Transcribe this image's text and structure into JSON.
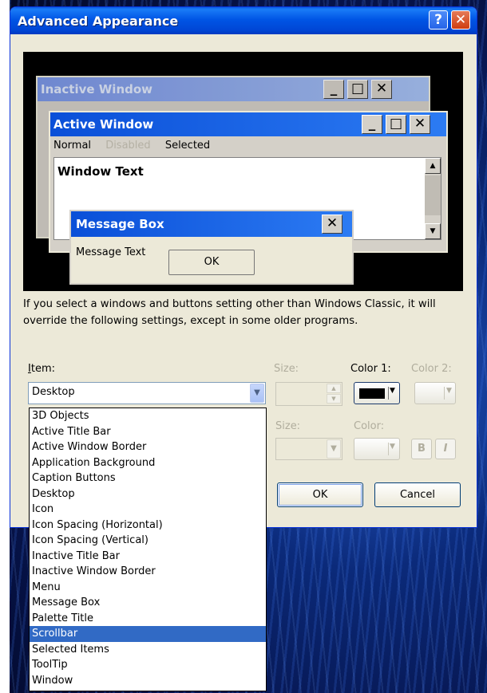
{
  "dialog": {
    "title": "Advanced Appearance",
    "help_glyph": "?",
    "close_glyph": "✕"
  },
  "preview": {
    "inactive_title": "Inactive Window",
    "active_title": "Active Window",
    "menu": [
      "Normal",
      "Disabled",
      "Selected"
    ],
    "window_text": "Window Text",
    "msgbox_title": "Message Box",
    "msgbox_text": "Message Text",
    "msgbox_ok": "OK",
    "caption_min": "_",
    "caption_max": "□",
    "caption_close": "✕"
  },
  "info_text": "If you select a windows and buttons setting other than Windows Classic, it will override the following settings, except in some older programs.",
  "item": {
    "label": "Item:",
    "value": "Desktop",
    "size_label": "Size:",
    "color1_label": "Color 1:",
    "color2_label": "Color 2:",
    "color1_value": "#000000"
  },
  "font": {
    "size_label": "Size:",
    "color_label": "Color:",
    "bold_label": "B",
    "italic_label": "I"
  },
  "buttons": {
    "ok": "OK",
    "cancel": "Cancel"
  },
  "item_list": {
    "items": [
      "3D Objects",
      "Active Title Bar",
      "Active Window Border",
      "Application Background",
      "Caption Buttons",
      "Desktop",
      "Icon",
      "Icon Spacing (Horizontal)",
      "Icon Spacing (Vertical)",
      "Inactive Title Bar",
      "Inactive Window Border",
      "Menu",
      "Message Box",
      "Palette Title",
      "Scrollbar",
      "Selected Items",
      "ToolTip",
      "Window"
    ],
    "highlighted": "Scrollbar"
  },
  "colors": {
    "titlebar": "#0055e5",
    "highlight": "#316ac5",
    "dialog_bg": "#ece9d8"
  }
}
